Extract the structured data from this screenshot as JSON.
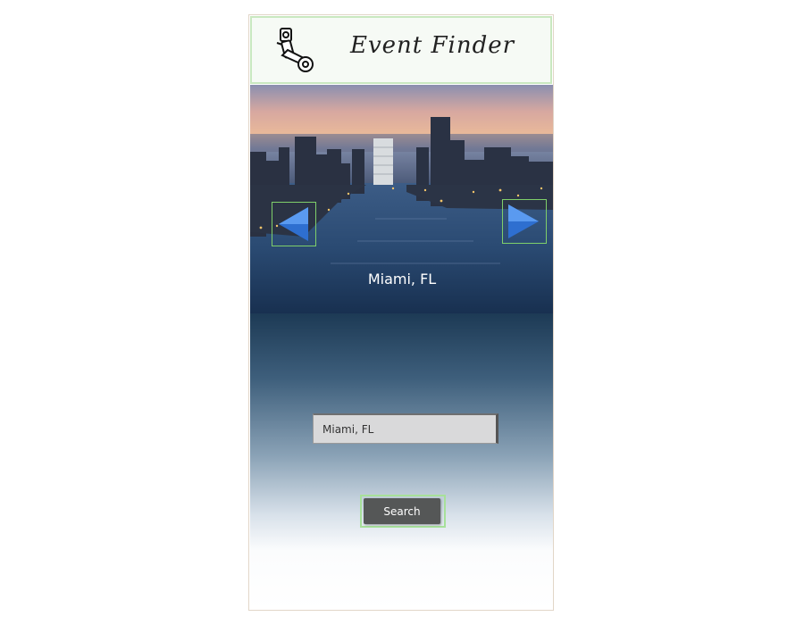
{
  "header": {
    "title": "Event Finder",
    "logo_icon": "film-camera-icon"
  },
  "carousel": {
    "city_label": "Miami, FL",
    "prev_icon": "arrow-left-icon",
    "next_icon": "arrow-right-icon",
    "arrow_color": "#3a7bd5"
  },
  "search": {
    "input_value": "Miami, FL",
    "button_label": "Search"
  },
  "colors": {
    "accent_border": "#a7e09a",
    "button_bg": "#555757"
  }
}
